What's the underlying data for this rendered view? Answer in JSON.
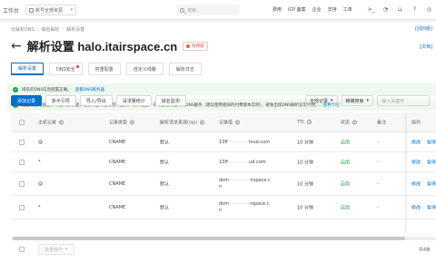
{
  "topbar": {
    "logo": "工作台",
    "resource_group": "账号全部资源",
    "search_placeholder": "搜索...",
    "nav": [
      "费用",
      "ICP 备案",
      "企业",
      "支持",
      "工单"
    ],
    "icons": [
      "terminal-icon",
      "bell-icon",
      "cart-icon",
      "help-icon",
      "globe-icon",
      "user-icon"
    ]
  },
  "breadcrumb": [
    "云解析DNS",
    "域名解析",
    "解析设置"
  ],
  "old_version_link": "[回旧版]",
  "page_title": "解析设置 halo.itairspace.cn",
  "badge": "免费版",
  "help_link": "[文档]",
  "tabs": [
    {
      "label": "解析设置",
      "active": true,
      "dot": false
    },
    {
      "label": "DNS安全",
      "active": false,
      "dot": true
    },
    {
      "label": "权重配置",
      "active": false,
      "dot": false
    },
    {
      "label": "自定义线路",
      "active": false,
      "dot": false
    },
    {
      "label": "解析日志",
      "active": false,
      "dot": false
    }
  ],
  "notices": [
    {
      "text": "域名的DNS信息配置正确。",
      "link": "查看DNS服务器"
    },
    {
      "text": "您正在使用独立子域名托管功能，若您的主域名也在阿里云，请保证主、子域名使用相同的DNS服务（建议使用相同的付费版本实例），避免出现DNS解析异常问题。",
      "link": "查看介绍"
    }
  ],
  "toolbar": {
    "buttons": [
      {
        "label": "添加记录",
        "primary": true
      },
      {
        "label": "新手引导",
        "primary": false
      },
      {
        "label": "导入/导出",
        "primary": false
      },
      {
        "label": "请求量统计",
        "primary": false
      },
      {
        "label": "域名监测",
        "primary": false
      }
    ],
    "filter_select": "全部记录",
    "search_mode": "精确搜索",
    "search_placeholder": "输入关键字"
  },
  "table": {
    "headers": [
      "主机记录",
      "记录类型",
      "解析请求来源(isp)",
      "记录值",
      "TTL",
      "状态",
      "备注",
      "操作"
    ],
    "rows": [
      {
        "host": "@",
        "type": "CNAME",
        "isp": "默认",
        "value_start": "13ff",
        "value_blur": "··················",
        "value_end": "loud.com",
        "ttl": "10 分钟",
        "status": "启用",
        "note": "-",
        "actions": [
          "修改",
          "暂停"
        ]
      },
      {
        "host": "*",
        "type": "CNAME",
        "isp": "默认",
        "value_start": "13ff",
        "value_blur": "··················",
        "value_end": "ud.com",
        "ttl": "10 分钟",
        "status": "启用",
        "note": "-",
        "actions": [
          "修改",
          "暂停"
        ]
      },
      {
        "host": "@",
        "type": "CNAME",
        "isp": "默认",
        "value_start": "dom",
        "value_blur": "··················",
        "value_end": "irspace.c",
        "value_line2": "n",
        "ttl": "10 分钟",
        "status": "启用",
        "note": "-",
        "actions": [
          "修改",
          "暂停"
        ]
      },
      {
        "host": "*",
        "type": "CNAME",
        "isp": "默认",
        "value_start": "dom",
        "value_blur": "··················",
        "value_end": "rspace.c",
        "value_line2": "n",
        "ttl": "10 分钟",
        "status": "启用",
        "note": "-",
        "actions": [
          "修改",
          "暂停"
        ]
      }
    ]
  },
  "footer": {
    "batch_label": "批量操作",
    "total_text": "共4条"
  },
  "colors": {
    "accent": "#0070cc",
    "success": "#22a34a",
    "notice_bg": "#eef8ee"
  }
}
